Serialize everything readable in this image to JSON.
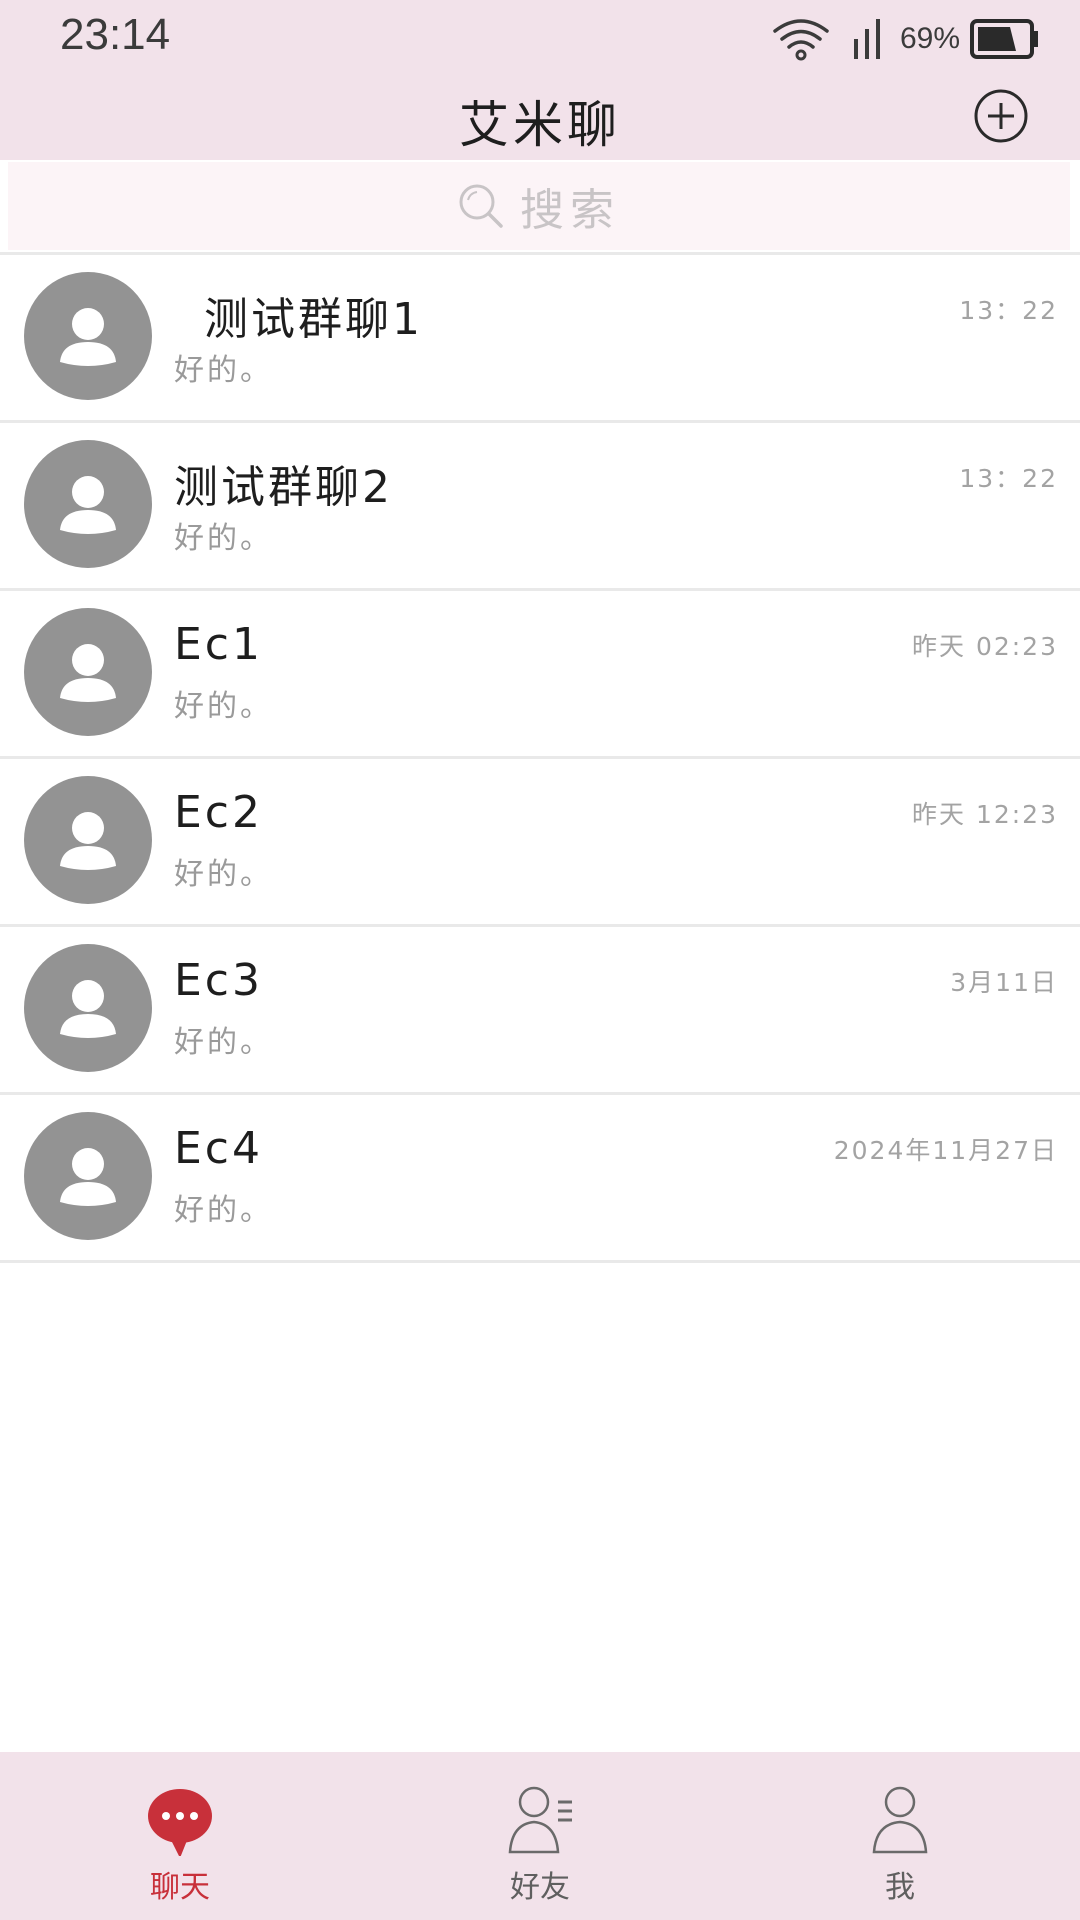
{
  "status_bar": {
    "time": "23:14",
    "battery_percent": "69%",
    "battery_level": 0.69,
    "icons": [
      "wifi-icon",
      "signal-icon",
      "battery-icon"
    ]
  },
  "header": {
    "title": "艾米聊",
    "add_icon": "plus-circle-icon"
  },
  "search": {
    "placeholder": "搜索",
    "icon": "search-icon"
  },
  "chats": [
    {
      "name": "测试群聊1",
      "preview": "好的。",
      "time": "13：22"
    },
    {
      "name": "测试群聊2",
      "preview": "好的。",
      "time": "13：22"
    },
    {
      "name": "Ec1",
      "preview": "好的。",
      "time": "昨天 02:23"
    },
    {
      "name": "Ec2",
      "preview": "好的。",
      "time": "昨天 12:23"
    },
    {
      "name": "Ec3",
      "preview": "好的。",
      "time": "3月11日"
    },
    {
      "name": "Ec4",
      "preview": "好的。",
      "time": "2024年11月27日"
    }
  ],
  "tabs": [
    {
      "label": "聊天",
      "icon": "chat-bubble-icon",
      "active": true
    },
    {
      "label": "好友",
      "icon": "friends-icon",
      "active": false
    },
    {
      "label": "我",
      "icon": "profile-icon",
      "active": false
    }
  ],
  "colors": {
    "bar_background": "#f2e2ea",
    "accent": "#c8303a",
    "avatar": "#939393"
  }
}
